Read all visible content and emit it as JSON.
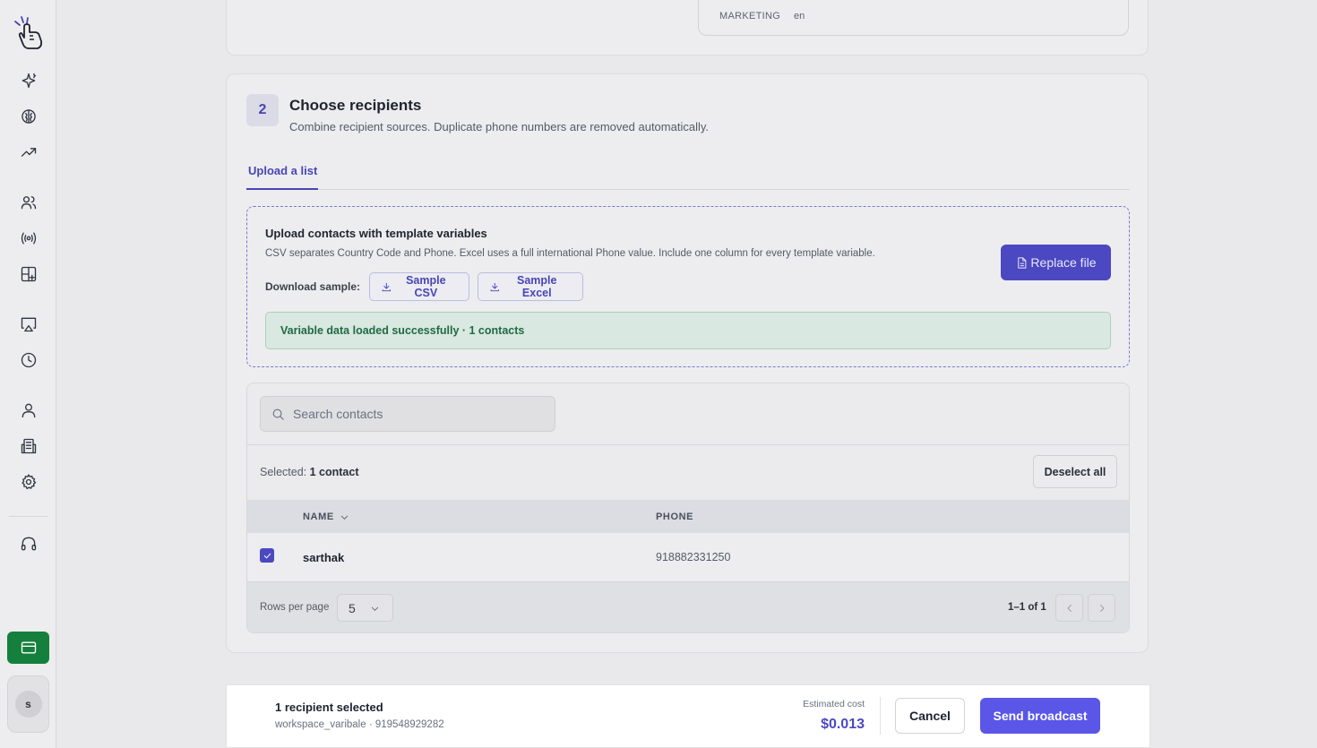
{
  "sidebar": {
    "items": [
      {
        "name": "sparkle-icon"
      },
      {
        "name": "brain-icon"
      },
      {
        "name": "trending-up-icon"
      },
      {
        "name": "users-icon"
      },
      {
        "name": "broadcast-icon"
      },
      {
        "name": "grid-plus-icon"
      },
      {
        "name": "monitor-icon"
      },
      {
        "name": "clock-icon"
      },
      {
        "name": "user-icon"
      },
      {
        "name": "building-icon"
      },
      {
        "name": "gear-icon"
      },
      {
        "name": "headphones-icon"
      }
    ],
    "billing_icon": "credit-card-icon",
    "avatar_initial": "s",
    "billing_color": "#15803d"
  },
  "template_meta": {
    "category": "MARKETING",
    "language": "en"
  },
  "step": {
    "number": "2",
    "title": "Choose recipients",
    "subtitle": "Combine recipient sources. Duplicate phone numbers are removed automatically."
  },
  "tabs": [
    {
      "label": "Upload a list",
      "active": true
    }
  ],
  "upload": {
    "title": "Upload contacts with template variables",
    "description": "CSV separates Country Code and Phone. Excel uses a full international Phone value. Include one column for every template variable.",
    "download_label": "Download sample:",
    "sample_csv_label": "Sample CSV",
    "sample_excel_label": "Sample Excel",
    "replace_label": "Replace file",
    "success_message": "Variable data loaded successfully · 1 contacts"
  },
  "contacts": {
    "search_placeholder": "Search contacts",
    "selected_prefix": "Selected:",
    "selected_value": "1 contact",
    "deselect_label": "Deselect all",
    "columns": {
      "name": "NAME",
      "phone": "PHONE"
    },
    "rows": [
      {
        "name": "sarthak",
        "phone": "918882331250",
        "checked": true
      }
    ],
    "rows_per_page_label": "Rows per page",
    "rows_per_page_value": "5",
    "range": "1–1 of 1"
  },
  "action_bar": {
    "title": "1 recipient selected",
    "subtitle": "workspace_varibale · 919548929282",
    "cost_label": "Estimated cost",
    "cost_value": "$0.013",
    "cancel_label": "Cancel",
    "send_label": "Send broadcast"
  },
  "colors": {
    "accent": "#4b48c2",
    "send_button": "#5a56e8",
    "success_text": "#1f6a42"
  }
}
